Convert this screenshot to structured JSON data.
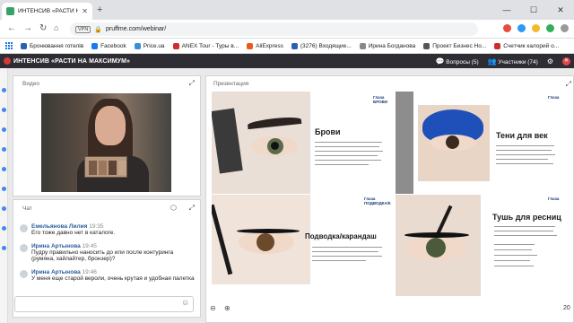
{
  "browser": {
    "tab_title": "ИНТЕНСИВ «РАСТИ НА М",
    "url": "pruffme.com/webinar/",
    "vpn_label": "VPN",
    "bookmarks": [
      {
        "label": "Бронювання готелів",
        "color": "#2b5fb4"
      },
      {
        "label": "Facebook",
        "color": "#1877f2"
      },
      {
        "label": "Price.ua",
        "color": "#3a8fd8"
      },
      {
        "label": "ANEX Tour - Туры в...",
        "color": "#d12b2b"
      },
      {
        "label": "AliExpress",
        "color": "#e65c1a"
      },
      {
        "label": "(3276) Входящие...",
        "color": "#2b5fb4"
      },
      {
        "label": "Ирина Богданова",
        "color": "#888888"
      },
      {
        "label": "Проект Бизнес Но...",
        "color": "#555555"
      },
      {
        "label": "Счетчик калорий о...",
        "color": "#d12b2b"
      }
    ]
  },
  "app": {
    "title": "ИНТЕНСИВ «РАСТИ НА МАКСИМУМ»",
    "questions": "Вопросы (5)",
    "participants": "Участники (74)"
  },
  "video": {
    "label": "Видео"
  },
  "chat": {
    "label": "Чат",
    "messages": [
      {
        "name": "Емельянова Лилия",
        "time": "19:35",
        "text": "Его тоже давно нет в каталоге."
      },
      {
        "name": "Ирина Артынова",
        "time": "19:45",
        "text": "Пудру правильно наносить до или после контуринга (румяна, хайлайтер, бронзер)?"
      },
      {
        "name": "Ирина Артынова",
        "time": "19:46",
        "text": "У меня еще старой вероли, очень крутая и удобная палетка"
      }
    ]
  },
  "presentation": {
    "label": "Презентация",
    "page": "20",
    "slides": [
      {
        "title": "Брови",
        "tag": "Глаза\nБРОВИ"
      },
      {
        "title": "Тени для век",
        "tag": "Глаза"
      },
      {
        "title": "Подводка/карандаш",
        "tag": "Глаза\nПОДВОДКА/КАРАНДАШ"
      },
      {
        "title": "Тушь для ресниц",
        "tag": "Глаза"
      }
    ]
  },
  "colors": {
    "header_bg": "#2d2d33",
    "accent_red": "#e04848",
    "name_blue": "#2a5d9f",
    "eyeshadow_blue": "#1f4fb8"
  }
}
